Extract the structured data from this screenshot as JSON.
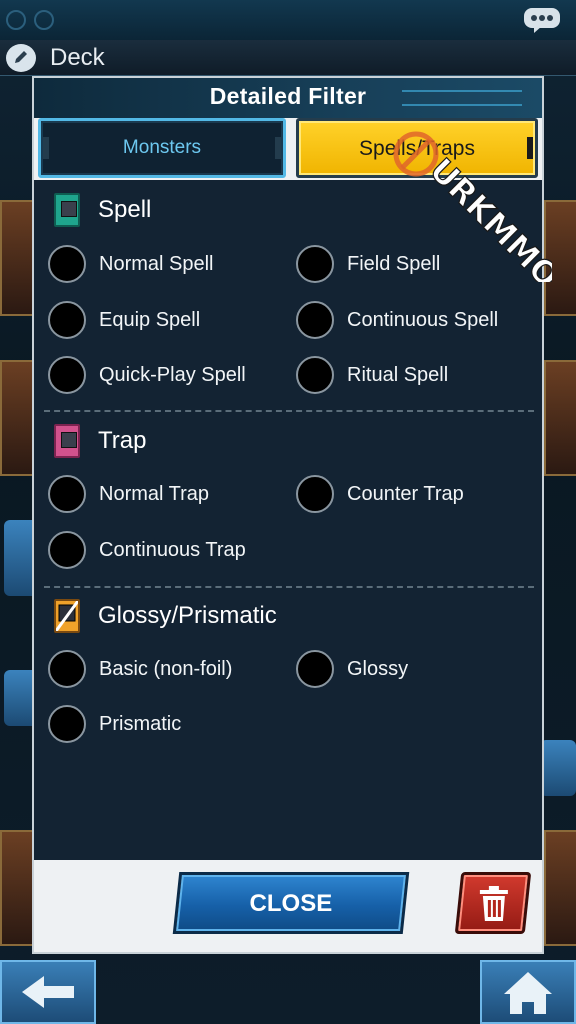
{
  "background": {
    "deck_title": "Deck"
  },
  "modal": {
    "title": "Detailed Filter",
    "tabs": [
      {
        "label": "Monsters",
        "active": false
      },
      {
        "label": "Spells/Traps",
        "active": true
      }
    ],
    "sections": {
      "spell": {
        "label": "Spell",
        "options": [
          "Normal Spell",
          "Field Spell",
          "Equip Spell",
          "Continuous Spell",
          "Quick-Play Spell",
          "Ritual Spell"
        ]
      },
      "trap": {
        "label": "Trap",
        "options": [
          "Normal Trap",
          "Counter Trap",
          "Continuous Trap"
        ]
      },
      "glossy": {
        "label": "Glossy/Prismatic",
        "options": [
          "Basic (non-foil)",
          "Glossy",
          "Prismatic"
        ]
      }
    },
    "close_label": "CLOSE"
  },
  "colors": {
    "tab_active": "#ffd22a",
    "tab_inactive_border": "#53b9e6",
    "panel_bg": "#132333",
    "close_button": "#1660a8",
    "trash_button": "#c0302a"
  },
  "icons": {
    "spell": "spell-card-icon",
    "trap": "trap-card-icon",
    "glossy": "glossy-card-icon",
    "delete": "trash-icon",
    "edit": "pencil-icon",
    "chat": "chat-bubble-icon"
  }
}
